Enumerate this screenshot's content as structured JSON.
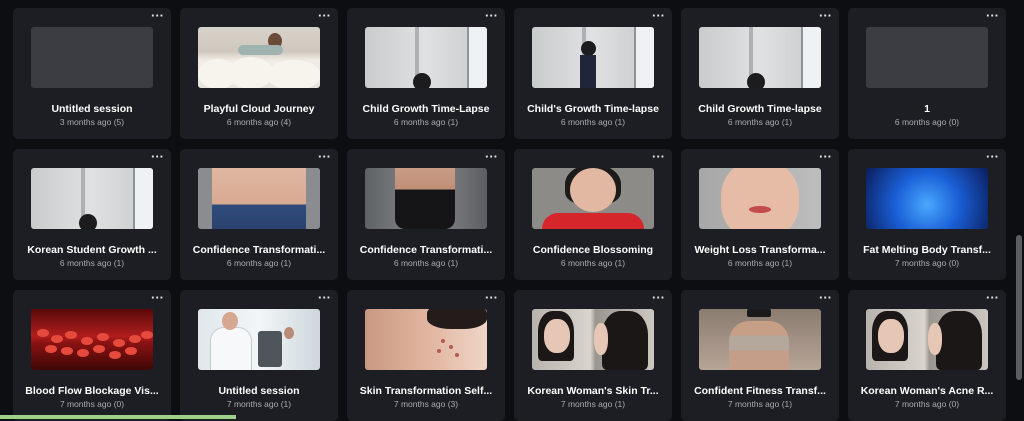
{
  "menu_label": "···",
  "cards": [
    {
      "title": "Untitled session",
      "meta": "3 months ago (5)",
      "thumb": "t-gray"
    },
    {
      "title": "Playful Cloud Journey",
      "meta": "6 months ago (4)",
      "thumb": "t-cloud"
    },
    {
      "title": "Child Growth Time-Lapse",
      "meta": "6 months ago (1)",
      "thumb": "t-wall-small"
    },
    {
      "title": "Child's Growth Time-lapse",
      "meta": "6 months ago (1)",
      "thumb": "t-wall-tall"
    },
    {
      "title": "Child Growth Time-lapse",
      "meta": "6 months ago (1)",
      "thumb": "t-wall-small"
    },
    {
      "title": "1",
      "meta": "6 months ago (0)",
      "thumb": "t-gray"
    },
    {
      "title": "Korean Student Growth ...",
      "meta": "6 months ago (1)",
      "thumb": "t-wall-small"
    },
    {
      "title": "Confidence Transformati...",
      "meta": "6 months ago (1)",
      "thumb": "t-belly"
    },
    {
      "title": "Confidence Transformati...",
      "meta": "6 months ago (1)",
      "thumb": "t-gym"
    },
    {
      "title": "Confidence Blossoming",
      "meta": "6 months ago (1)",
      "thumb": "t-face"
    },
    {
      "title": "Weight Loss Transforma...",
      "meta": "6 months ago (1)",
      "thumb": "t-face2"
    },
    {
      "title": "Fat Melting Body Transf...",
      "meta": "7 months ago (0)",
      "thumb": "t-blue"
    },
    {
      "title": "Blood Flow Blockage Vis...",
      "meta": "7 months ago (0)",
      "thumb": "t-blood"
    },
    {
      "title": "Untitled session",
      "meta": "7 months ago (1)",
      "thumb": "t-lab"
    },
    {
      "title": "Skin Transformation Self...",
      "meta": "7 months ago (3)",
      "thumb": "t-skin"
    },
    {
      "title": "Korean Woman's Skin Tr...",
      "meta": "7 months ago (1)",
      "thumb": "t-mirror"
    },
    {
      "title": "Confident Fitness Transf...",
      "meta": "7 months ago (1)",
      "thumb": "t-fit"
    },
    {
      "title": "Korean Woman's Acne R...",
      "meta": "7 months ago (0)",
      "thumb": "t-mirror"
    }
  ]
}
